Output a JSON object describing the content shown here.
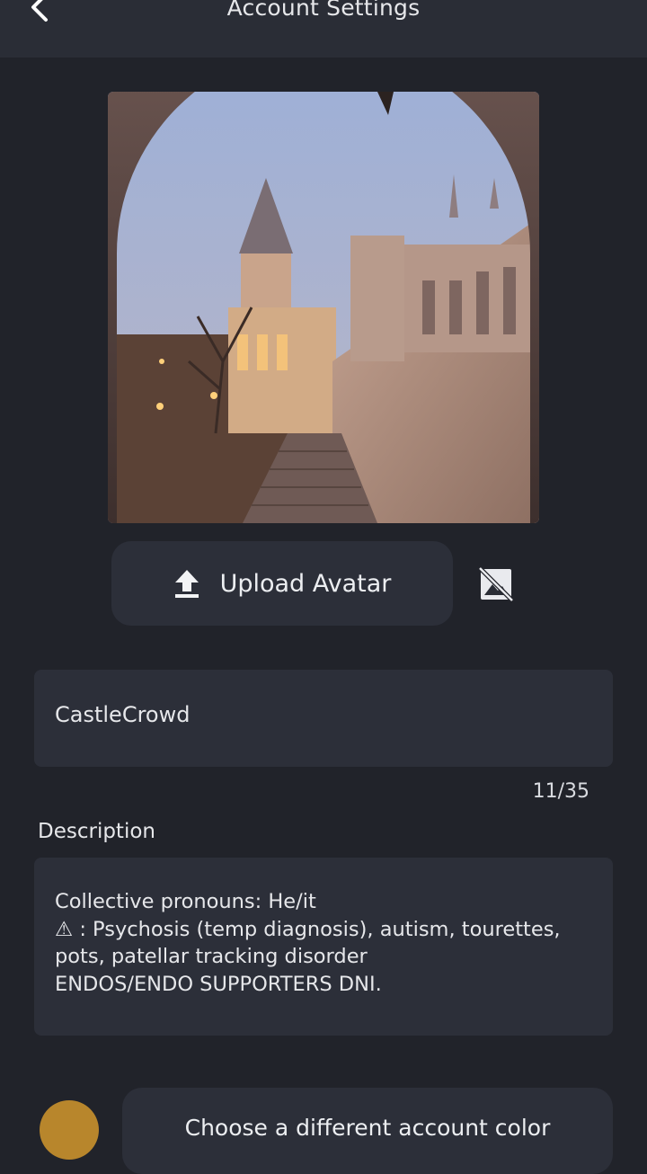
{
  "header": {
    "title": "Account Settings",
    "back_icon": "chevron-left-icon"
  },
  "avatar": {
    "alt": "Castle archway avatar photo"
  },
  "upload": {
    "label": "Upload Avatar",
    "icon": "upload-icon",
    "remove_icon": "image-off-icon"
  },
  "name": {
    "value": "CastleCrowd",
    "counter": "11/35"
  },
  "description": {
    "label": "Description",
    "lines": [
      "Collective pronouns: He/it",
      "⚠ : Psychosis (temp diagnosis), autism, tourettes,",
      "pots, patellar tracking disorder",
      "ENDOS/ENDO SUPPORTERS DNI."
    ]
  },
  "account_color": {
    "button_label": "Choose a different account color",
    "color": "#b8862c"
  },
  "colors": {
    "background": "#21232a",
    "surface": "#2c2f39",
    "topbar": "#2a2d36"
  }
}
